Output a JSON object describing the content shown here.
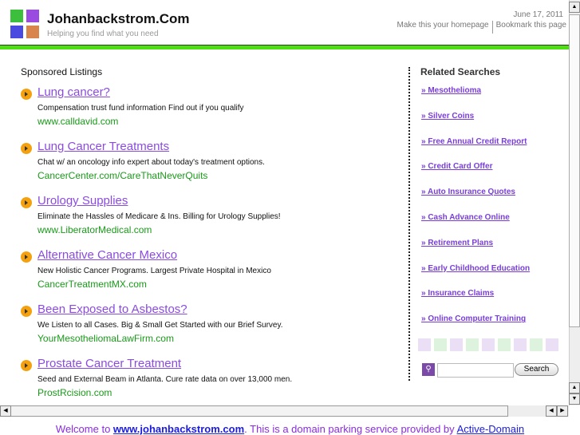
{
  "header": {
    "title": "Johanbackstrom.Com",
    "tagline": "Helping you find what you need",
    "date": "June 17, 2011",
    "homepage_link": "Make this your homepage",
    "bookmark_link": "Bookmark this page"
  },
  "colors": {
    "accent_bar": "#4ce010",
    "link": "#8a4ce0",
    "url": "#1a9a1a"
  },
  "sponsored": {
    "heading": "Sponsored Listings",
    "ads": [
      {
        "title": "Lung cancer?",
        "desc": "Compensation trust fund information Find out if you qualify",
        "url": "www.calldavid.com"
      },
      {
        "title": "Lung Cancer Treatments",
        "desc": "Chat w/ an oncology info expert about today's treatment options.",
        "url": "CancerCenter.com/CareThatNeverQuits"
      },
      {
        "title": "Urology Supplies",
        "desc": "Eliminate the Hassles of Medicare & Ins. Billing for Urology Supplies!",
        "url": "www.LiberatorMedical.com"
      },
      {
        "title": "Alternative Cancer Mexico",
        "desc": "New Holistic Cancer Programs. Largest Private Hospital in Mexico",
        "url": "CancerTreatmentMX.com"
      },
      {
        "title": "Been Exposed to Asbestos?",
        "desc": "We Listen to all Cases. Big & Small Get Started with our Brief Survey.",
        "url": "YourMesotheliomaLawFirm.com"
      },
      {
        "title": "Prostate Cancer Treatment",
        "desc": "Seed and External Beam in Atlanta. Cure rate data on over 13,000 men.",
        "url": "ProstRcision.com"
      }
    ]
  },
  "related": {
    "heading": "Related Searches",
    "items": [
      "» Mesothelioma",
      "» Silver Coins",
      "» Free Annual Credit Report",
      "» Credit Card Offer",
      "» Auto Insurance Quotes",
      "» Cash Advance Online",
      "» Retirement Plans",
      "» Early Childhood Education",
      "» Insurance Claims",
      "» Online Computer Training"
    ]
  },
  "search": {
    "value": "",
    "button": "Search"
  },
  "footer": {
    "prefix": "Welcome to ",
    "domain": "www.johanbackstrom.com",
    "middle": ". This is a domain parking service provided by ",
    "provider": "Active-Domain"
  }
}
